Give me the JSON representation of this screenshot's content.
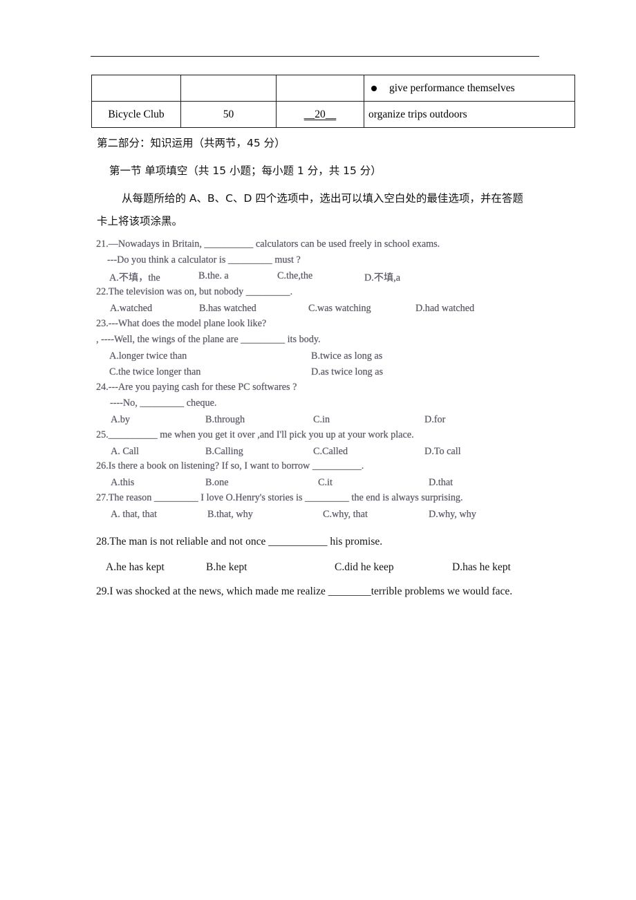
{
  "document": {
    "type": "exam-paper",
    "language": "zh-CN / en"
  },
  "table": {
    "rows": [
      {
        "club": "",
        "members": "",
        "fee": "",
        "activity": "give performance themselves",
        "has_bullet": true
      },
      {
        "club": "Bicycle Club",
        "members": "50",
        "fee": "__20__",
        "activity": "organize trips outdoors",
        "has_bullet": false
      }
    ]
  },
  "headings": {
    "part_two": "第二部分：知识运用（共两节，45 分）",
    "section_one": "第一节 单项填空（共 15 小题；每小题 1 分，共 15 分）",
    "instruction_line1": "从每题所给的 A、B、C、D 四个选项中，选出可以填入空白处的最佳选项，并在答题",
    "instruction_line2": "卡上将该项涂黑。"
  },
  "questions": [
    {
      "number": "21",
      "stem_lines": [
        "21.—Nowadays in Britain, __________ calculators can be used freely in school exams.",
        "---Do you think a calculator is _________ must ?"
      ],
      "options": [
        "A.不填，the",
        "B.the. a",
        "C.the,the",
        "D.不填,a"
      ],
      "layout": "row4",
      "style": "scan"
    },
    {
      "number": "22",
      "stem_lines": [
        "22.The television was on, but nobody _________."
      ],
      "options": [
        "A.watched",
        "B.has watched",
        "C.was watching",
        "D.had watched"
      ],
      "layout": "row4",
      "style": "scan"
    },
    {
      "number": "23",
      "stem_lines": [
        "23.---What does the model plane look like?",
        ", ----Well, the wings of the plane are _________ its body."
      ],
      "options": [
        "A.longer twice than",
        "B.twice as long as",
        "C.the twice longer than",
        "D.as twice long as"
      ],
      "layout": "grid2x2",
      "style": "scan"
    },
    {
      "number": "24",
      "stem_lines": [
        "24.---Are you paying cash for these PC softwares ?",
        "----No, _________ cheque."
      ],
      "options": [
        "A.by",
        "B.through",
        "C.in",
        "D.for"
      ],
      "layout": "row4",
      "style": "scan"
    },
    {
      "number": "25",
      "stem_lines": [
        "25.__________ me when you get it over ,and I'll pick you up at your work place."
      ],
      "options": [
        "A. Call",
        "B.Calling",
        "C.Called",
        "D.To call"
      ],
      "layout": "row4",
      "style": "scan"
    },
    {
      "number": "26",
      "stem_lines": [
        "26.Is there a book on listening? If so, I want to borrow __________."
      ],
      "options": [
        "A.this",
        "B.one",
        "C.it",
        "D.that"
      ],
      "layout": "row4",
      "style": "scan"
    },
    {
      "number": "27",
      "stem_lines": [
        "27.The reason _________ I love O.Henry's stories is _________ the end is always surprising."
      ],
      "options": [
        "A. that, that",
        "B.that, why",
        "C.why, that",
        "D.why, why"
      ],
      "layout": "row4",
      "style": "scan"
    },
    {
      "number": "28",
      "stem_lines": [
        "28.The man is not reliable and not once ___________ his promise."
      ],
      "options": [
        "A.he has kept",
        "B.he kept",
        "C.did he keep",
        "D.has he kept"
      ],
      "layout": "row4",
      "style": "sharp"
    },
    {
      "number": "29",
      "stem_lines": [
        "29.I was shocked at the news, which made me realize ________terrible problems we would face."
      ],
      "options": [],
      "layout": "none",
      "style": "sharp"
    }
  ]
}
